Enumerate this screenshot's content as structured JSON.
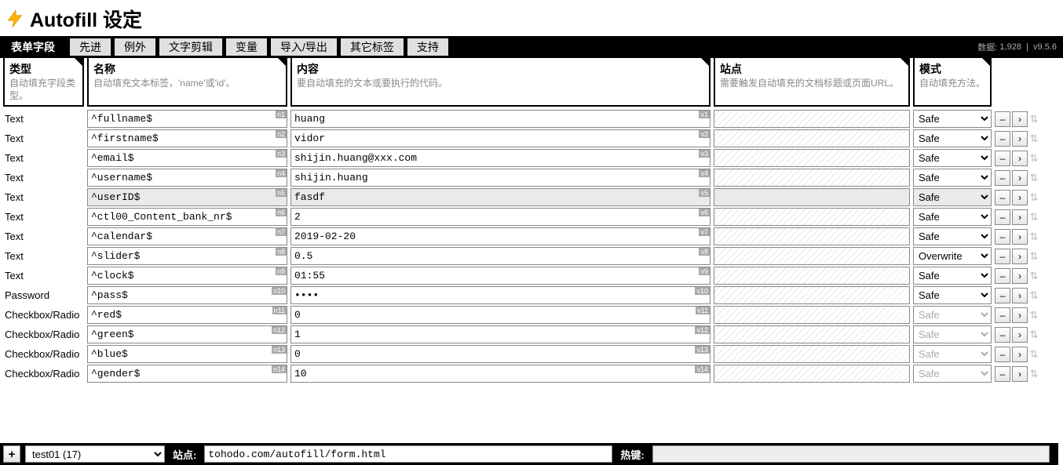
{
  "header": {
    "title": "Autofill 设定"
  },
  "tabs": {
    "items": [
      "表单字段",
      "先进",
      "例外",
      "文字剪辑",
      "变量",
      "导入/导出",
      "其它标签",
      "支持"
    ],
    "active_index": 0
  },
  "meta": {
    "data_label": "数据:",
    "data_count": "1,928",
    "version": "v9.5.6"
  },
  "columns": {
    "type": {
      "title": "类型",
      "sub": "自动填充字段类型。"
    },
    "name": {
      "title": "名称",
      "sub": "自动填充文本标签，'name'或'id'。"
    },
    "value": {
      "title": "内容",
      "sub": "要自动填充的文本或要执行的代码。"
    },
    "site": {
      "title": "站点",
      "sub": "需要触发自动填充的文档标题或页面URL。"
    },
    "mode": {
      "title": "模式",
      "sub": "自动填充方法。"
    }
  },
  "rows": [
    {
      "type": "Text",
      "name": "^fullname$",
      "n_badge": "n1",
      "value": "huang",
      "v_badge": "v1",
      "site": "",
      "mode": "Safe",
      "disabled": false,
      "selected": false
    },
    {
      "type": "Text",
      "name": "^firstname$",
      "n_badge": "n2",
      "value": "vidor",
      "v_badge": "v2",
      "site": "",
      "mode": "Safe",
      "disabled": false,
      "selected": false
    },
    {
      "type": "Text",
      "name": "^email$",
      "n_badge": "n3",
      "value": "shijin.huang@xxx.com",
      "v_badge": "v3",
      "site": "",
      "mode": "Safe",
      "disabled": false,
      "selected": false
    },
    {
      "type": "Text",
      "name": "^username$",
      "n_badge": "n4",
      "value": "shijin.huang",
      "v_badge": "v4",
      "site": "",
      "mode": "Safe",
      "disabled": false,
      "selected": false
    },
    {
      "type": "Text",
      "name": "^userID$",
      "n_badge": "n5",
      "value": "fasdf",
      "v_badge": "v5",
      "site": "",
      "mode": "Safe",
      "disabled": false,
      "selected": true
    },
    {
      "type": "Text",
      "name": "^ctl00_Content_bank_nr$",
      "n_badge": "n6",
      "value": "2",
      "v_badge": "v6",
      "site": "",
      "mode": "Safe",
      "disabled": false,
      "selected": false
    },
    {
      "type": "Text",
      "name": "^calendar$",
      "n_badge": "n7",
      "value": "2019-02-20",
      "v_badge": "v7",
      "site": "",
      "mode": "Safe",
      "disabled": false,
      "selected": false
    },
    {
      "type": "Text",
      "name": "^slider$",
      "n_badge": "n8",
      "value": "0.5",
      "v_badge": "v8",
      "site": "",
      "mode": "Overwrite",
      "disabled": false,
      "selected": false
    },
    {
      "type": "Text",
      "name": "^clock$",
      "n_badge": "n9",
      "value": "01:55",
      "v_badge": "v9",
      "site": "",
      "mode": "Safe",
      "disabled": false,
      "selected": false
    },
    {
      "type": "Password",
      "name": "^pass$",
      "n_badge": "n10",
      "value": "••••",
      "v_badge": "v10",
      "site": "",
      "mode": "Safe",
      "disabled": false,
      "selected": false
    },
    {
      "type": "Checkbox/Radio",
      "name": "^red$",
      "n_badge": "n11",
      "value": "0",
      "v_badge": "v11",
      "site": "",
      "mode": "Safe",
      "disabled": true,
      "selected": false
    },
    {
      "type": "Checkbox/Radio",
      "name": "^green$",
      "n_badge": "n12",
      "value": "1",
      "v_badge": "v12",
      "site": "",
      "mode": "Safe",
      "disabled": true,
      "selected": false
    },
    {
      "type": "Checkbox/Radio",
      "name": "^blue$",
      "n_badge": "n13",
      "value": "0",
      "v_badge": "v13",
      "site": "",
      "mode": "Safe",
      "disabled": true,
      "selected": false
    },
    {
      "type": "Checkbox/Radio",
      "name": "^gender$",
      "n_badge": "n14",
      "value": "10",
      "v_badge": "v14",
      "site": "",
      "mode": "Safe",
      "disabled": true,
      "selected": false
    }
  ],
  "footer": {
    "plus_label": "+",
    "profile": "test01 (17)",
    "site_label": "站点:",
    "site_value": "tohodo.com/autofill/form.html",
    "hotkey_label": "热键:",
    "hotkey_value": ""
  },
  "buttons": {
    "minus": "–",
    "arrow": "›",
    "drag": "⇅"
  }
}
